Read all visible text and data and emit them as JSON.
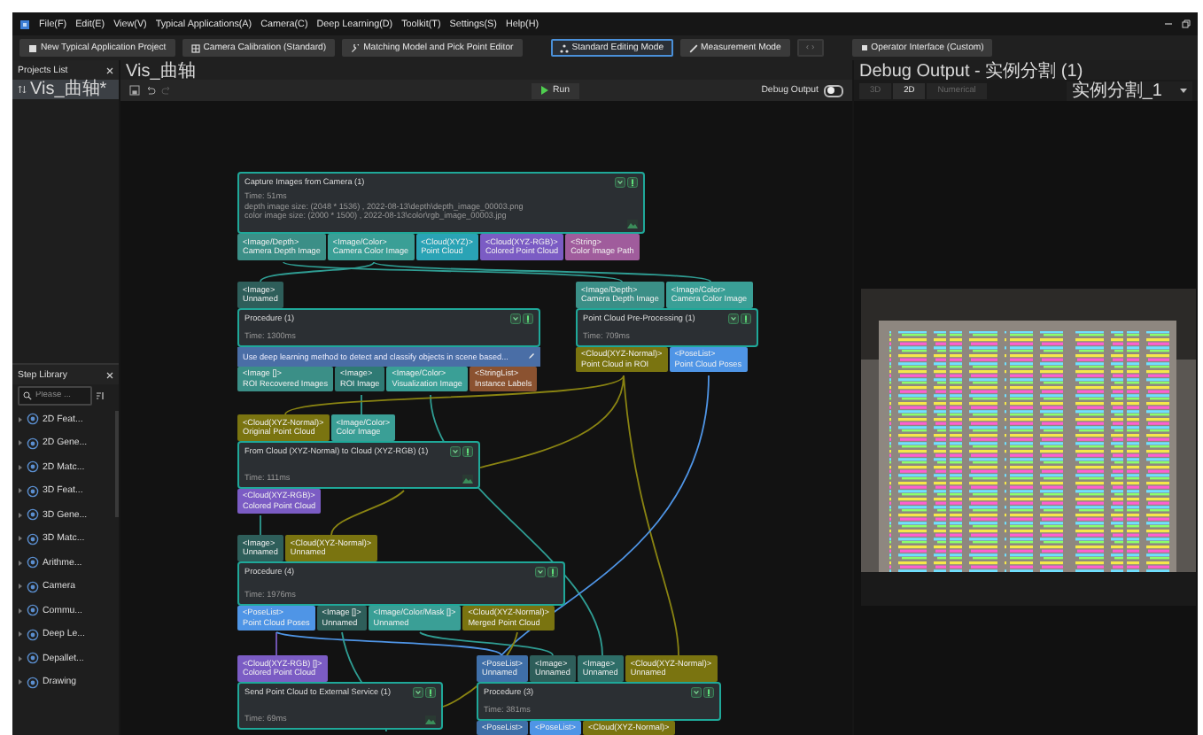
{
  "menu": [
    "File(F)",
    "Edit(E)",
    "View(V)",
    "Typical Applications(A)",
    "Camera(C)",
    "Deep Learning(D)",
    "Toolkit(T)",
    "Settings(S)",
    "Help(H)"
  ],
  "toolbar": [
    {
      "label": "New Typical Application Project",
      "selected": false,
      "disabled": false
    },
    {
      "label": "Camera Calibration (Standard)",
      "selected": false,
      "disabled": false
    },
    {
      "label": "Matching Model and Pick Point Editor",
      "selected": false,
      "disabled": false
    },
    {
      "label": "Standard Editing Mode",
      "selected": true,
      "disabled": false
    },
    {
      "label": "Measurement Mode",
      "selected": false,
      "disabled": false
    },
    {
      "label": "‹ ›",
      "selected": false,
      "disabled": true
    },
    {
      "label": "Operator Interface (Custom)",
      "selected": false,
      "disabled": false
    }
  ],
  "projects_list": {
    "title": "Projects List",
    "items": [
      {
        "label": "Vis_曲轴*",
        "selected": true
      }
    ]
  },
  "step_library": {
    "title": "Step Library",
    "search": {
      "placeholder": "Please ..."
    },
    "items": [
      {
        "label": "2D Feat..."
      },
      {
        "label": "2D Gene..."
      },
      {
        "label": "2D Matc..."
      },
      {
        "label": "3D Feat..."
      },
      {
        "label": "3D Gene..."
      },
      {
        "label": "3D Matc..."
      },
      {
        "label": "Arithme..."
      },
      {
        "label": "Camera"
      },
      {
        "label": "Commu..."
      },
      {
        "label": "Deep Le..."
      },
      {
        "label": "Depallet..."
      },
      {
        "label": "Drawing"
      }
    ]
  },
  "editor": {
    "tab": "Vis_曲轴",
    "run_button": "Run",
    "debug_output": {
      "label": "Debug Output",
      "on": false
    },
    "nodes": [
      {
        "title": "Capture Images from Camera (1)",
        "time": "Time: 51ms",
        "details": [
          "depth image size: (2048 * 1536) , 2022-08-13\\depth\\depth_image_00003.png",
          "color image size: (2000 * 1500) , 2022-08-13\\color\\rgb_image_00003.jpg"
        ],
        "has_preview": true,
        "outputs": [
          {
            "type": "<Image/Depth>",
            "name": "Camera Depth Image",
            "color": "#3b8f87"
          },
          {
            "type": "<Image/Color>",
            "name": "Camera Color Image",
            "color": "#3a9f96"
          },
          {
            "type": "<Cloud(XYZ)>",
            "name": "Point Cloud",
            "color": "#2aa3b5"
          },
          {
            "type": "<Cloud(XYZ-RGB)>",
            "name": "Colored Point Cloud",
            "color": "#7b5cc4"
          },
          {
            "type": "<String>",
            "name": "Color Image Path",
            "color": "#a05c9c"
          }
        ]
      },
      {
        "title": "Procedure (1)",
        "time": "Time: 1300ms",
        "description": "Use deep learning method to detect and classify objects in scene based...",
        "has_preview": false,
        "inputs": [
          {
            "type": "<Image>",
            "name": "Unnamed",
            "color": "#2e5e5a"
          }
        ],
        "outputs": [
          {
            "type": "<Image []>",
            "name": "ROI Recovered Images",
            "color": "#3b8f87"
          },
          {
            "type": "<Image>",
            "name": "ROI Image",
            "color": "#2f7a74"
          },
          {
            "type": "<Image/Color>",
            "name": "Visualization Image",
            "color": "#3a9f96"
          },
          {
            "type": "<StringList>",
            "name": "Instance Labels",
            "color": "#8b5230"
          }
        ]
      },
      {
        "title": "Point Cloud Pre-Processing (1)",
        "time": "Time: 709ms",
        "has_preview": false,
        "inputs": [
          {
            "type": "<Image/Depth>",
            "name": "Camera Depth Image",
            "color": "#3b8f87"
          },
          {
            "type": "<Image/Color>",
            "name": "Camera Color Image",
            "color": "#3a9f96"
          }
        ],
        "outputs": [
          {
            "type": "<Cloud(XYZ-Normal)>",
            "name": "Point Cloud in ROI",
            "color": "#7a7410"
          },
          {
            "type": "<PoseList>",
            "name": "Point Cloud Poses",
            "color": "#4f95e6"
          }
        ]
      },
      {
        "title": "From Cloud (XYZ-Normal) to Cloud (XYZ-RGB) (1)",
        "time": "Time: 111ms",
        "has_preview": true,
        "inputs": [
          {
            "type": "<Cloud(XYZ-Normal)>",
            "name": "Original Point Cloud",
            "color": "#7a7410"
          },
          {
            "type": "<Image/Color>",
            "name": "Color Image",
            "color": "#3a9f96"
          }
        ],
        "outputs": [
          {
            "type": "<Cloud(XYZ-RGB)>",
            "name": "Colored Point Cloud",
            "color": "#7b5cc4"
          }
        ]
      },
      {
        "title": "Procedure (4)",
        "time": "Time: 1976ms",
        "has_preview": false,
        "inputs": [
          {
            "type": "<Image>",
            "name": "Unnamed",
            "color": "#2e5e5a"
          },
          {
            "type": "<Cloud(XYZ-Normal)>",
            "name": "Unnamed",
            "color": "#7a7410"
          }
        ],
        "outputs": [
          {
            "type": "<PoseList>",
            "name": "Point Cloud Poses",
            "color": "#4f95e6"
          },
          {
            "type": "<Image []>",
            "name": "Unnamed",
            "color": "#2e5e5a"
          },
          {
            "type": "<Image/Color/Mask []>",
            "name": "Unnamed",
            "color": "#3a9f96"
          },
          {
            "type": "<Cloud(XYZ-Normal)>",
            "name": "Merged Point Cloud",
            "color": "#7a7410"
          }
        ]
      },
      {
        "title": "Send Point Cloud to External Service (1)",
        "time": "Time: 69ms",
        "has_preview": true,
        "inputs": [
          {
            "type": "<Cloud(XYZ-RGB) []>",
            "name": "Colored Point Cloud",
            "color": "#7b5cc4"
          }
        ]
      },
      {
        "title": "Procedure (3)",
        "time": "Time: 381ms",
        "has_preview": false,
        "inputs": [
          {
            "type": "<PoseList>",
            "name": "Unnamed",
            "color": "#3f6fa8"
          },
          {
            "type": "<Image>",
            "name": "Unnamed",
            "color": "#2e5e5a"
          },
          {
            "type": "<Image>",
            "name": "Unnamed",
            "color": "#2e6e68"
          },
          {
            "type": "<Cloud(XYZ-Normal)>",
            "name": "Unnamed",
            "color": "#7a7410"
          }
        ],
        "outputs": [
          {
            "type": "<PoseList>",
            "color": "#3f6fa8"
          },
          {
            "type": "<PoseList>",
            "color": "#4f95e6"
          },
          {
            "type": "<Cloud(XYZ-Normal)>",
            "color": "#7a7410"
          }
        ]
      }
    ]
  },
  "debug_panel": {
    "title": "Debug Output - 实例分割 (1)",
    "tabs": [
      {
        "label": "3D",
        "selected": false
      },
      {
        "label": "2D",
        "selected": true
      },
      {
        "label": "Numerical",
        "selected": false
      }
    ],
    "dropdown": "实例分割_1"
  }
}
